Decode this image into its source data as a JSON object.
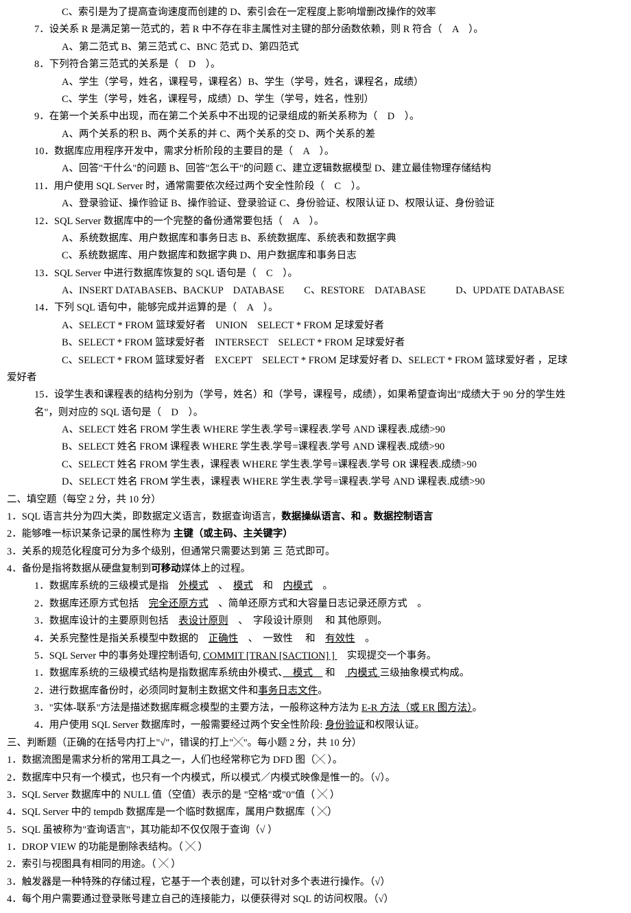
{
  "q6_c": "C、索引是为了提高查询速度而创建的 D、索引会在一定程度上影响增删改操作的效率",
  "q7_stem": "7．设关系 R 是满足第一范式的，若 R 中不存在非主属性对主键的部分函数依赖，则 R 符合（　A　）。",
  "q7_opts": "A、第二范式 B、第三范式 C、BNC 范式 D、第四范式",
  "q8_stem": "8．下列符合第三范式的关系是（　D　）。",
  "q8_opts_a": "A、学生（学号，姓名，课程号，课程名）B、学生（学号，姓名，课程名，成绩）",
  "q8_opts_c": "C、学生（学号，姓名，课程号，成绩）D、学生（学号，姓名，性别）",
  "q9_stem": "9．在第一个关系中出现，而在第二个关系中不出现的记录组成的新关系称为（　D　）。",
  "q9_opts": "A、两个关系的积 B、两个关系的并 C、两个关系的交 D、两个关系的差",
  "q10_stem": "10．数据库应用程序开发中，需求分析阶段的主要目的是（　A　）。",
  "q10_opts": "A、回答\"干什么\"的问题 B、回答\"怎么干\"的问题 C、建立逻辑数据模型 D、建立最佳物理存储结构",
  "q11_stem": "11．用户使用 SQL Server 时，通常需要依次经过两个安全性阶段（　C　）。",
  "q11_opts": "A、登录验证、操作验证 B、操作验证、登录验证 C、身份验证、权限认证 D、权限认证、身份验证",
  "q12_stem": "12．SQL Server 数据库中的一个完整的备份通常要包括（　A　）。",
  "q12_opts_a": "A、系统数据库、用户数据库和事务日志 B、系统数据库、系统表和数据字典",
  "q12_opts_c": "C、系统数据库、用户数据库和数据字典 D、用户数据库和事务日志",
  "q13_stem": "13．SQL Server 中进行数据库恢复的 SQL 语句是（　C　）。",
  "q13_opts": "A、INSERT DATABASEB、BACKUP　DATABASE　　C、RESTORE　DATABASE　　　D、UPDATE DATABASE",
  "q14_stem": "14．下列 SQL 语句中，能够完成并运算的是（　A　）。",
  "q14_a": "A、SELECT * FROM  篮球爱好者　UNION　SELECT * FROM  足球爱好者",
  "q14_b": "B、SELECT * FROM  篮球爱好者　INTERSECT　SELECT * FROM  足球爱好者",
  "q14_c": "C、SELECT * FROM  篮球爱好者　EXCEPT　SELECT * FROM  足球爱好者 D、SELECT * FROM  篮球爱好者  ，足球",
  "q14_tail": "爱好者",
  "q15_stem_a": "15．设学生表和课程表的结构分别为（学号，姓名）和（学号，课程号，成绩），如果希望查询出\"成绩大于 90 分的学生姓",
  "q15_stem_b": "名\"，则对应的 SQL 语句是（　D　）。",
  "q15_a": "A、SELECT  姓名  FROM  学生表  WHERE  学生表.学号=课程表.学号  AND  课程表.成绩>90",
  "q15_b": "B、SELECT  姓名  FROM  课程表  WHERE  学生表.学号=课程表.学号  AND  课程表.成绩>90",
  "q15_c": "C、SELECT  姓名  FROM  学生表，课程表  WHERE  学生表.学号=课程表.学号  OR  课程表.成绩>90",
  "q15_d": "D、SELECT  姓名  FROM  学生表，课程表  WHERE  学生表.学号=课程表.学号  AND  课程表.成绩>90",
  "sec2_title": "二、填空题（每空 2 分，共 10 分）",
  "f1_a": "1．SQL 语言共分为四大类，即数据定义语言，数据查询语言，",
  "f1_b": "数据操纵语言、和 。数据控制语言",
  "f2_a": "2．能够唯一标识某条记录的属性称为 ",
  "f2_b": "主键（或主码、主关键字）",
  "f3": "3．关系的规范化程度可分为多个级别，但通常只需要达到第  三  范式即可。",
  "f4_a": "4．备份是指将数据从硬盘复制到",
  "f4_b": "可移动",
  "f4_c": "媒体上的过程。",
  "f4_1a": "1．数据库系统的三级模式是指　",
  "f4_1b": "外模式",
  "f4_1c": "　、　",
  "f4_1d": "模式",
  "f4_1e": "　和　",
  "f4_1f": "内模式",
  "f4_1g": "　。",
  "f4_2a": "2．数据库还原方式包括　",
  "f4_2b": "完全还原方式",
  "f4_2c": "　、简单还原方式和大容量日志记录还原方式　。",
  "f4_3a": "3．数据库设计的主要原则包括　",
  "f4_3b": "表设计原则",
  "f4_3c": "　、　字段设计原则　 和 其他原则。",
  "f4_4a": "4．关系完整性是指关系模型中数据的　",
  "f4_4b": "正确性",
  "f4_4c": "　、　一致性　 和　",
  "f4_4d": "有效性",
  "f4_4e": "　。",
  "f4_5a": "5．SQL Server  中的事务处理控制语句, ",
  "f4_5b": " COMMIT [TRAN [SACTION] ] ",
  "f4_5c": "　实现提交一个事务。",
  "f4_6a": "1．数据库系统的三级模式结构是指数据库系统由外模式、",
  "f4_6b": "　模式　",
  "f4_6c": " 和　",
  "f4_6d": " 内模式 ",
  "f4_6e": "三级抽象模式构成。",
  "f4_7a": "2．进行数据库备份时，必须同时复制主数据文件和",
  "f4_7b": "事务日志文件",
  "f4_7c": "。",
  "f4_8a": "3．\"实体-联系\"方法是描述数据库概念模型的主要方法，一般称这种方法为 ",
  "f4_8b": "E-R 方法（或 ER 图方法）",
  "f4_8c": "。",
  "f4_9a": "4．用户使用 SQL Server 数据库时，一般需要经过两个安全性阶段: ",
  "f4_9b": "身份验证",
  "f4_9c": "和权限认证。",
  "sec3_title": "三、判断题（正确的在括号内打上\"√\"，错误的打上\"╳\"。每小题 2 分，共 10 分）",
  "j1": "1．数据流图是需求分析的常用工具之一，人们也经常称它为 DFD 图（╳ ）。",
  "j2": "2．数据库中只有一个模式，也只有一个内模式，所以模式／内模式映像是惟一的。（√）。",
  "j3": "3．SQL Server 数据库中的 NULL 值（空值）表示的是 \"空格\"或\"0\"值（ ╳ ）",
  "j4": "4．SQL Server 中的 tempdb 数据库是一个临时数据库，属用户数据库（ ╳）",
  "j5": "5．SQL 虽被称为\"查询语言\"，其功能却不仅仅限于查询（√ ）",
  "j6": "1．DROP VIEW 的功能是删除表结构。（ ╳ ）",
  "j7": "2．索引与视图具有相同的用途。（ ╳ ）",
  "j8": "3．触发器是一种特殊的存储过程，它基于一个表创建，可以针对多个表进行操作。（√）",
  "j9": "4．每个用户需要通过登录账号建立自己的连接能力，以便获得对 SQL 的访问权限。（√）"
}
